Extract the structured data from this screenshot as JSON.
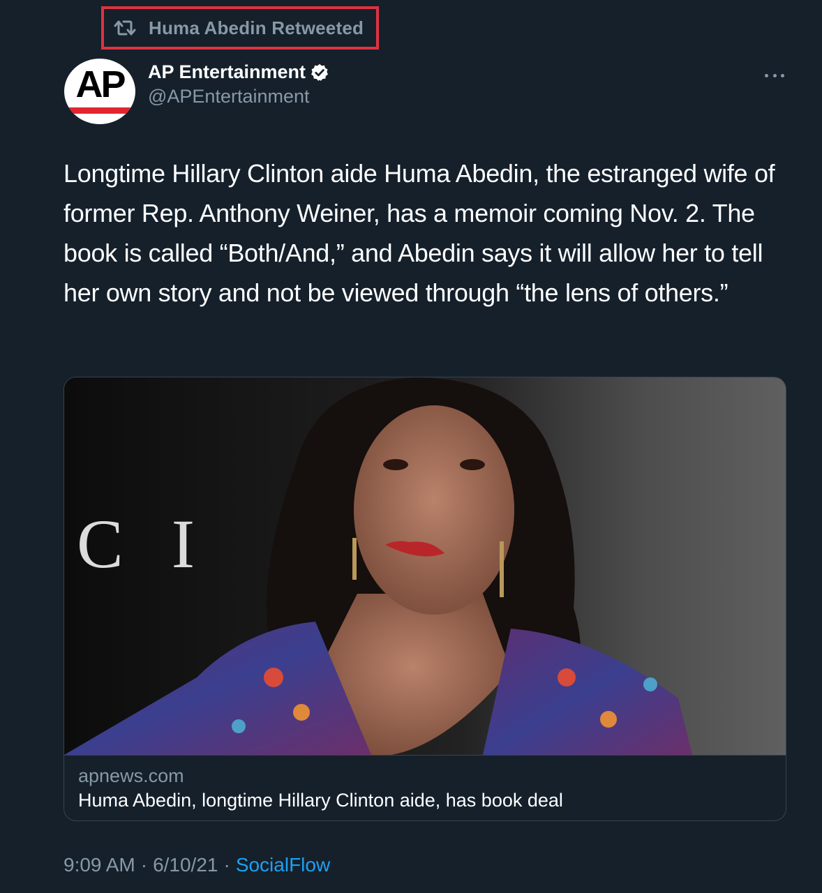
{
  "retweet": {
    "label": "Huma Abedin Retweeted",
    "icon": "retweet-icon"
  },
  "author": {
    "avatar_text": "AP",
    "display_name": "AP Entertainment",
    "handle": "@APEntertainment",
    "verified": true
  },
  "tweet": {
    "text": "Longtime Hillary Clinton aide Huma Abedin, the estranged wife of former Rep. Anthony Weiner, has a memoir coming Nov. 2. The book is called “Both/And,” and Abedin says it will allow her to tell her own story and not be viewed through “the lens of others.”"
  },
  "card": {
    "image_text": "C I",
    "domain": "apnews.com",
    "title": "Huma Abedin, longtime Hillary Clinton aide, has book deal"
  },
  "footer": {
    "time": "9:09 AM",
    "date": "6/10/21",
    "separator": "·",
    "source": "SocialFlow"
  },
  "colors": {
    "background": "#15202b",
    "secondary_text": "#8899a6",
    "link": "#1da1f2",
    "highlight_border": "#e0323f",
    "ap_red": "#e1262f"
  }
}
